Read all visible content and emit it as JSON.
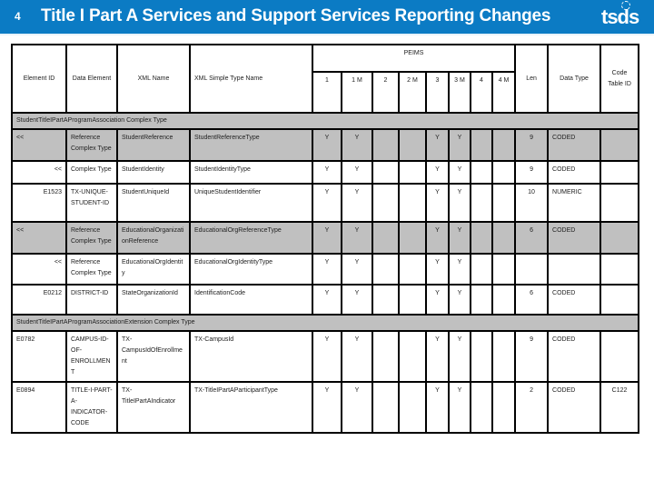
{
  "header": {
    "slide_number": "4",
    "title": "Title I Part A Services and Support Services Reporting Changes",
    "logo_text": "tsds",
    "banner_color": "#0b7bc4"
  },
  "table": {
    "group_header": "PEIMS",
    "columns": {
      "element_id": "Element ID",
      "data_element": "Data Element",
      "xml_name": "XML Name",
      "xml_simple_type": "XML Simple Type Name",
      "p1": "1",
      "p1m": "1 M",
      "p2": "2",
      "p2m": "2 M",
      "p3": "3",
      "p3m": "3 M",
      "p4": "4",
      "p4m": "4 M",
      "len": "Len",
      "data_type": "Data Type",
      "code_table": "Code Table ID"
    },
    "sections": [
      {
        "title": "StudentTitleIPartAProgramAssociation Complex Type",
        "rows": [
          {
            "element_id": "<<",
            "data_element": "Reference Complex Type",
            "xml_name": "StudentReference",
            "xml_simple_type": "StudentReferenceType",
            "p1": "Y",
            "p1m": "Y",
            "p2": "",
            "p2m": "",
            "p3": "Y",
            "p3m": "Y",
            "p4": "",
            "p4m": "",
            "len": "9",
            "data_type": "CODED",
            "code_table": "",
            "shaded": true,
            "id_align": "left"
          },
          {
            "element_id": "<<",
            "data_element": "Complex Type",
            "xml_name": "StudentIdentity",
            "xml_simple_type": "StudentIdentityType",
            "p1": "Y",
            "p1m": "Y",
            "p2": "",
            "p2m": "",
            "p3": "Y",
            "p3m": "Y",
            "p4": "",
            "p4m": "",
            "len": "9",
            "data_type": "CODED",
            "code_table": "",
            "shaded": false,
            "id_align": "right"
          },
          {
            "element_id": "E1523",
            "data_element": "TX-UNIQUE-STUDENT-ID",
            "xml_name": "StudentUniqueId",
            "xml_simple_type": "UniqueStudentIdentifier",
            "p1": "Y",
            "p1m": "Y",
            "p2": "",
            "p2m": "",
            "p3": "Y",
            "p3m": "Y",
            "p4": "",
            "p4m": "",
            "len": "10",
            "data_type": "NUMERIC",
            "code_table": "",
            "shaded": false,
            "id_align": "right"
          },
          {
            "element_id": "<<",
            "data_element": "Reference Complex Type",
            "xml_name": "EducationalOrganizationReference",
            "xml_simple_type": "EducationalOrgReferenceType",
            "p1": "Y",
            "p1m": "Y",
            "p2": "",
            "p2m": "",
            "p3": "Y",
            "p3m": "Y",
            "p4": "",
            "p4m": "",
            "len": "6",
            "data_type": "CODED",
            "code_table": "",
            "shaded": true,
            "id_align": "left"
          },
          {
            "element_id": "<<",
            "data_element": "Reference Complex Type",
            "xml_name": "EducationalOrgIdentity",
            "xml_simple_type": "EducationalOrgIdentityType",
            "p1": "Y",
            "p1m": "Y",
            "p2": "",
            "p2m": "",
            "p3": "Y",
            "p3m": "Y",
            "p4": "",
            "p4m": "",
            "len": "",
            "data_type": "",
            "code_table": "",
            "shaded": false,
            "id_align": "right"
          },
          {
            "element_id": "E0212",
            "data_element": "DISTRICT-ID",
            "xml_name": "StateOrganizationId",
            "xml_simple_type": "IdentificationCode",
            "p1": "Y",
            "p1m": "Y",
            "p2": "",
            "p2m": "",
            "p3": "Y",
            "p3m": "Y",
            "p4": "",
            "p4m": "",
            "len": "6",
            "data_type": "CODED",
            "code_table": "",
            "shaded": false,
            "id_align": "right"
          }
        ]
      },
      {
        "title": "StudentTitleIPartAProgramAssociationExtension Complex Type",
        "rows": [
          {
            "element_id": "E0782",
            "data_element": "CAMPUS-ID-OF-ENROLLMENT",
            "xml_name": "TX-CampusIdOfEnrollment",
            "xml_simple_type": "TX-CampusId",
            "p1": "Y",
            "p1m": "Y",
            "p2": "",
            "p2m": "",
            "p3": "Y",
            "p3m": "Y",
            "p4": "",
            "p4m": "",
            "len": "9",
            "data_type": "CODED",
            "code_table": "",
            "shaded": false,
            "id_align": "left"
          },
          {
            "element_id": "E0894",
            "data_element": "TITLE-I-PART-A-INDICATOR-CODE",
            "xml_name": "TX-TitleIPartAIndicator",
            "xml_simple_type": "TX-TitleIPartAParticipantType",
            "p1": "Y",
            "p1m": "Y",
            "p2": "",
            "p2m": "",
            "p3": "Y",
            "p3m": "Y",
            "p4": "",
            "p4m": "",
            "len": "2",
            "data_type": "CODED",
            "code_table": "C122",
            "shaded": false,
            "id_align": "left"
          }
        ]
      }
    ]
  }
}
